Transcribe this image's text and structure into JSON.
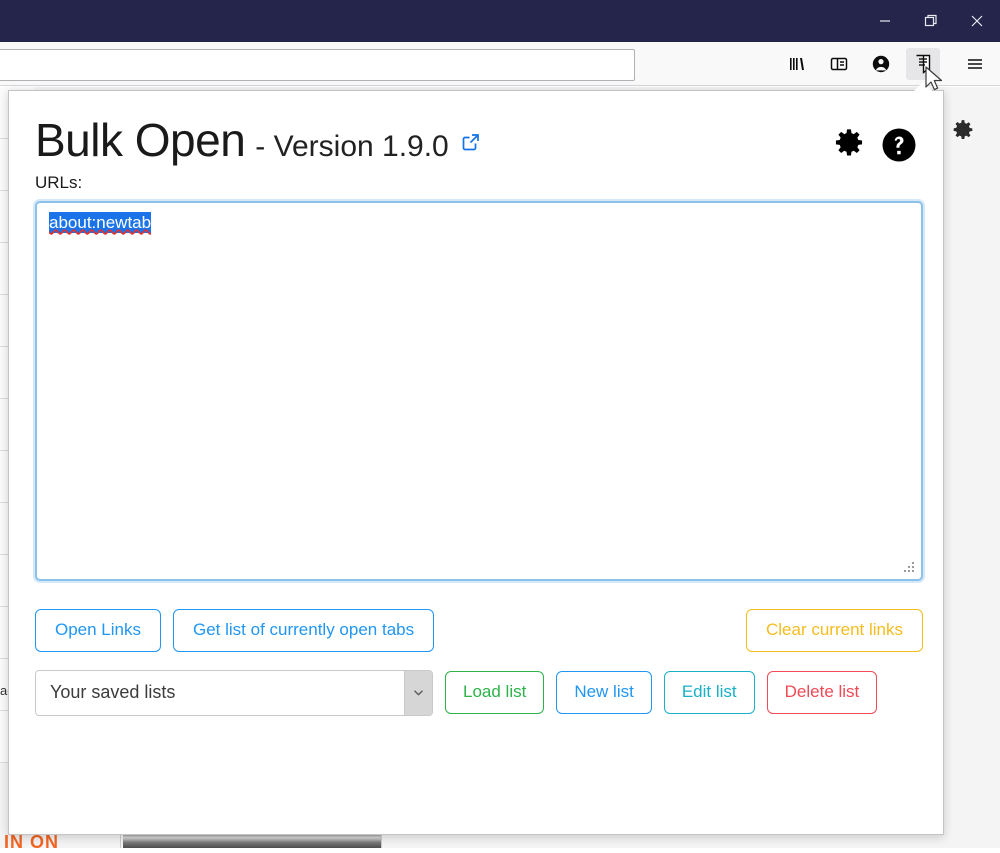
{
  "window": {
    "controls": [
      {
        "name": "minimize-button",
        "glyph": "minimize"
      },
      {
        "name": "restore-button",
        "glyph": "restore"
      },
      {
        "name": "close-button",
        "glyph": "close"
      }
    ]
  },
  "browser": {
    "urlbar": {
      "value": "",
      "placeholder": ""
    },
    "toolbar": [
      {
        "name": "library-icon",
        "label": "Library"
      },
      {
        "name": "sidebar-icon",
        "label": "Sidebars"
      },
      {
        "name": "account-icon",
        "label": "Account"
      },
      {
        "name": "bulk-open-extension-icon",
        "label": "Bulk Open",
        "active": true
      },
      {
        "name": "hamburger-menu-icon",
        "label": "Open application menu"
      }
    ]
  },
  "popup": {
    "title": "Bulk Open",
    "version": "- Version 1.9.0",
    "external_link_icon": "external-link-icon",
    "settings_icon": "gear-icon",
    "help_icon": "help-circle-icon",
    "urls_label": "URLs:",
    "textarea": {
      "value": "about:newtab",
      "selected": true,
      "spellcheck_underline": true
    },
    "actions": [
      {
        "name": "open-links-button",
        "label": "Open Links",
        "style": "blue"
      },
      {
        "name": "get-open-tabs-button",
        "label": "Get list of currently open tabs",
        "style": "blue"
      },
      {
        "name": "clear-current-links-button",
        "label": "Clear current links",
        "style": "amber"
      }
    ],
    "saved_lists": {
      "selected": "Your saved lists",
      "options": [
        "Your saved lists"
      ],
      "chevron_icon": "chevron-down-icon"
    },
    "list_actions": [
      {
        "name": "load-list-button",
        "label": "Load list",
        "style": "green"
      },
      {
        "name": "new-list-button",
        "label": "New list",
        "style": "blue"
      },
      {
        "name": "edit-list-button",
        "label": "Edit list",
        "style": "teal"
      },
      {
        "name": "delete-list-button",
        "label": "Delete list",
        "style": "red"
      }
    ]
  },
  "background_page": {
    "gear_icon": "gear-icon",
    "truncated_text": "ac",
    "colors": {
      "titlebar": "#25244a",
      "accent_blue": "#2196f3",
      "amber": "#f5bc20",
      "green": "#2eb24a",
      "teal": "#19b0c8",
      "red": "#ef4a56",
      "selection_blue": "#1a73e8"
    }
  }
}
